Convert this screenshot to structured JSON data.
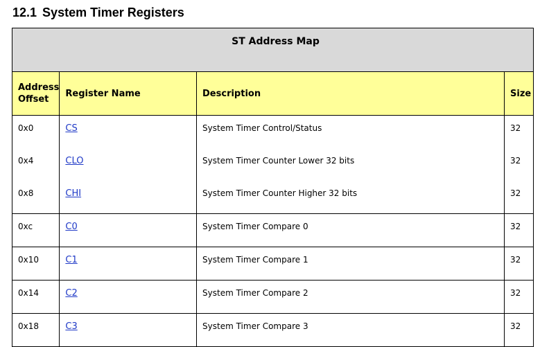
{
  "heading": {
    "number": "12.1",
    "title": "System Timer Registers"
  },
  "table": {
    "caption": "ST Address Map",
    "headers": {
      "offset": "Address Offset",
      "name": "Register Name",
      "description": "Description",
      "size": "Size"
    },
    "rows": [
      {
        "offset": "0x0",
        "name": "CS",
        "description": "System Timer Control/Status",
        "size": "32"
      },
      {
        "offset": "0x4",
        "name": "CLO",
        "description": "System Timer Counter Lower 32 bits",
        "size": "32"
      },
      {
        "offset": "0x8",
        "name": "CHI",
        "description": "System Timer Counter Higher 32 bits",
        "size": "32"
      },
      {
        "offset": "0xc",
        "name": "C0",
        "description": "System Timer Compare 0",
        "size": "32"
      },
      {
        "offset": "0x10",
        "name": "C1",
        "description": "System Timer Compare 1",
        "size": "32"
      },
      {
        "offset": "0x14",
        "name": "C2",
        "description": "System Timer Compare 2",
        "size": "32"
      },
      {
        "offset": "0x18",
        "name": "C3",
        "description": "System Timer Compare 3",
        "size": "32"
      }
    ]
  },
  "colors": {
    "caption_bg": "#d9d9d9",
    "header_bg": "#ffff99",
    "link": "#1f39c7"
  }
}
